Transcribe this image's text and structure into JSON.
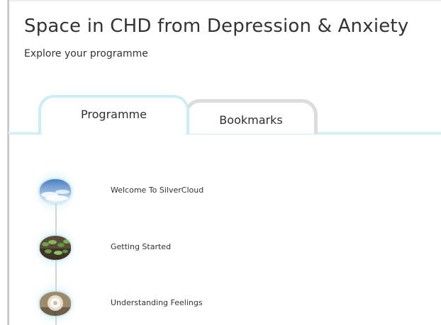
{
  "page": {
    "title": "Space in CHD from Depression & Anxiety",
    "subtitle": "Explore your programme"
  },
  "tabs": [
    {
      "label": "Programme",
      "active": true
    },
    {
      "label": "Bookmarks",
      "active": false
    }
  ],
  "modules": [
    {
      "label": "Welcome To SilverCloud",
      "thumbnail": "sky-clouds-image"
    },
    {
      "label": "Getting Started",
      "thumbnail": "seedlings-image"
    },
    {
      "label": "Understanding Feelings",
      "thumbnail": "dandelion-image"
    }
  ],
  "colors": {
    "accent": "#cbeef6",
    "inactive_tab": "#dcdcdc",
    "text": "#333333"
  }
}
